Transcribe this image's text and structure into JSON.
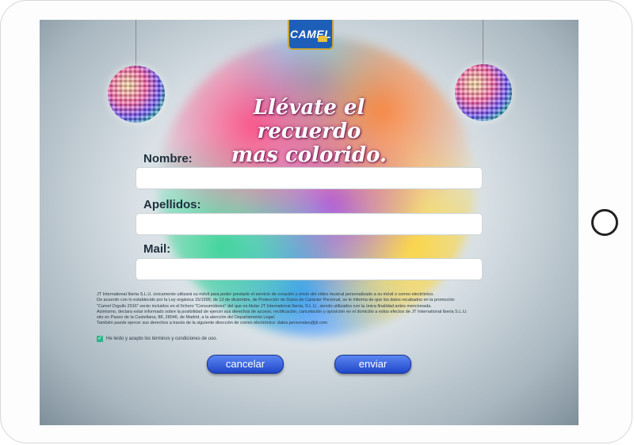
{
  "brand": {
    "logo_text": "CAMEL"
  },
  "headline": {
    "line1": "Llévate el recuerdo",
    "line2": "mas colorido."
  },
  "form": {
    "nombre_label": "Nombre:",
    "nombre_value": "",
    "apellidos_label": "Apellidos:",
    "apellidos_value": "",
    "mail_label": "Mail:",
    "mail_value": ""
  },
  "legal": {
    "line1": "JT International Iberia S.L.U. únicamente utilizará su móvil para poder prestarle el servicio de creación y envío del vídeo musical personalizado a su móvil o correo electrónico.",
    "line2": "De acuerdo con lo establecido por la Ley orgánica 15/1999, de 13 de diciembre, de Protección de Datos de Carácter Personal, se le informa de que los datos recabados en la promoción",
    "line3": "\"Camel Orgullo 2016\" serán incluidos en el fichero \"Consumidores\" del que es titular JT International Iberia, S.L.U., siendo utilizados con la única finalidad antes mencionada.",
    "line4": "Asimismo, declara estar informado sobre la posibilidad de ejercer sus derechos de acceso, rectificación, cancelación y oposición en el domicilio a estos efectos de JT International Iberia S.L.U.",
    "line5": "sito en Paseo de la Castellana, 88, 28046, de Madrid, a la atención del Departamento Legal.",
    "line6": "También puede ejercer sus derechos a través de la siguiente dirección de correo electrónico: datos.personales@jti.com"
  },
  "consent": {
    "checked": true,
    "label": "He leído y acepto los términos y condiciones de uso."
  },
  "buttons": {
    "cancel_label": "cancelar",
    "submit_label": "enviar"
  },
  "colors": {
    "button_blue": "#2f5ad8",
    "label_text": "#1e2f3c",
    "brand_blue": "#1d5fb8"
  }
}
